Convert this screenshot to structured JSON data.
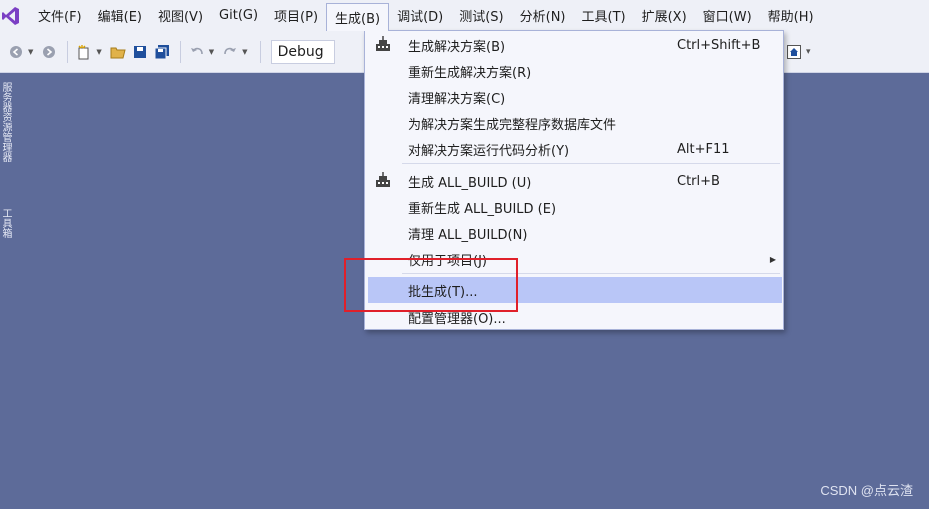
{
  "menubar": {
    "logo_icon": "visual-studio-logo-icon",
    "items": [
      {
        "label": "文件(F)"
      },
      {
        "label": "编辑(E)"
      },
      {
        "label": "视图(V)"
      },
      {
        "label": "Git(G)"
      },
      {
        "label": "项目(P)"
      },
      {
        "label": "生成(B)"
      },
      {
        "label": "调试(D)"
      },
      {
        "label": "测试(S)"
      },
      {
        "label": "分析(N)"
      },
      {
        "label": "工具(T)"
      },
      {
        "label": "扩展(X)"
      },
      {
        "label": "窗口(W)"
      },
      {
        "label": "帮助(H)"
      }
    ]
  },
  "toolbar": {
    "config_value": "Debug"
  },
  "side_tabs": [
    {
      "label": "服务器资源管理器"
    },
    {
      "label": "工具箱"
    }
  ],
  "build_menu": {
    "items": [
      {
        "label": "生成解决方案(B)",
        "shortcut": "Ctrl+Shift+B",
        "icon": "build-solution-icon"
      },
      {
        "label": "重新生成解决方案(R)",
        "shortcut": ""
      },
      {
        "label": "清理解决方案(C)",
        "shortcut": ""
      },
      {
        "label": "为解决方案生成完整程序数据库文件",
        "shortcut": ""
      },
      {
        "label": "对解决方案运行代码分析(Y)",
        "shortcut": "Alt+F11"
      },
      {
        "label": "生成 ALL_BUILD (U)",
        "shortcut": "Ctrl+B",
        "icon": "build-project-icon"
      },
      {
        "label": "重新生成 ALL_BUILD (E)",
        "shortcut": ""
      },
      {
        "label": "清理 ALL_BUILD(N)",
        "shortcut": ""
      },
      {
        "label": "仅用于项目(J)",
        "shortcut": "",
        "submenu": true
      },
      {
        "label": "批生成(T)...",
        "shortcut": "",
        "highlighted": true
      },
      {
        "label": "配置管理器(O)...",
        "shortcut": ""
      }
    ]
  },
  "colors": {
    "background": "#5d6b99",
    "highlight": "#b9c6f7",
    "annotation": "#e0202a"
  },
  "watermark": "CSDN @点云渣"
}
